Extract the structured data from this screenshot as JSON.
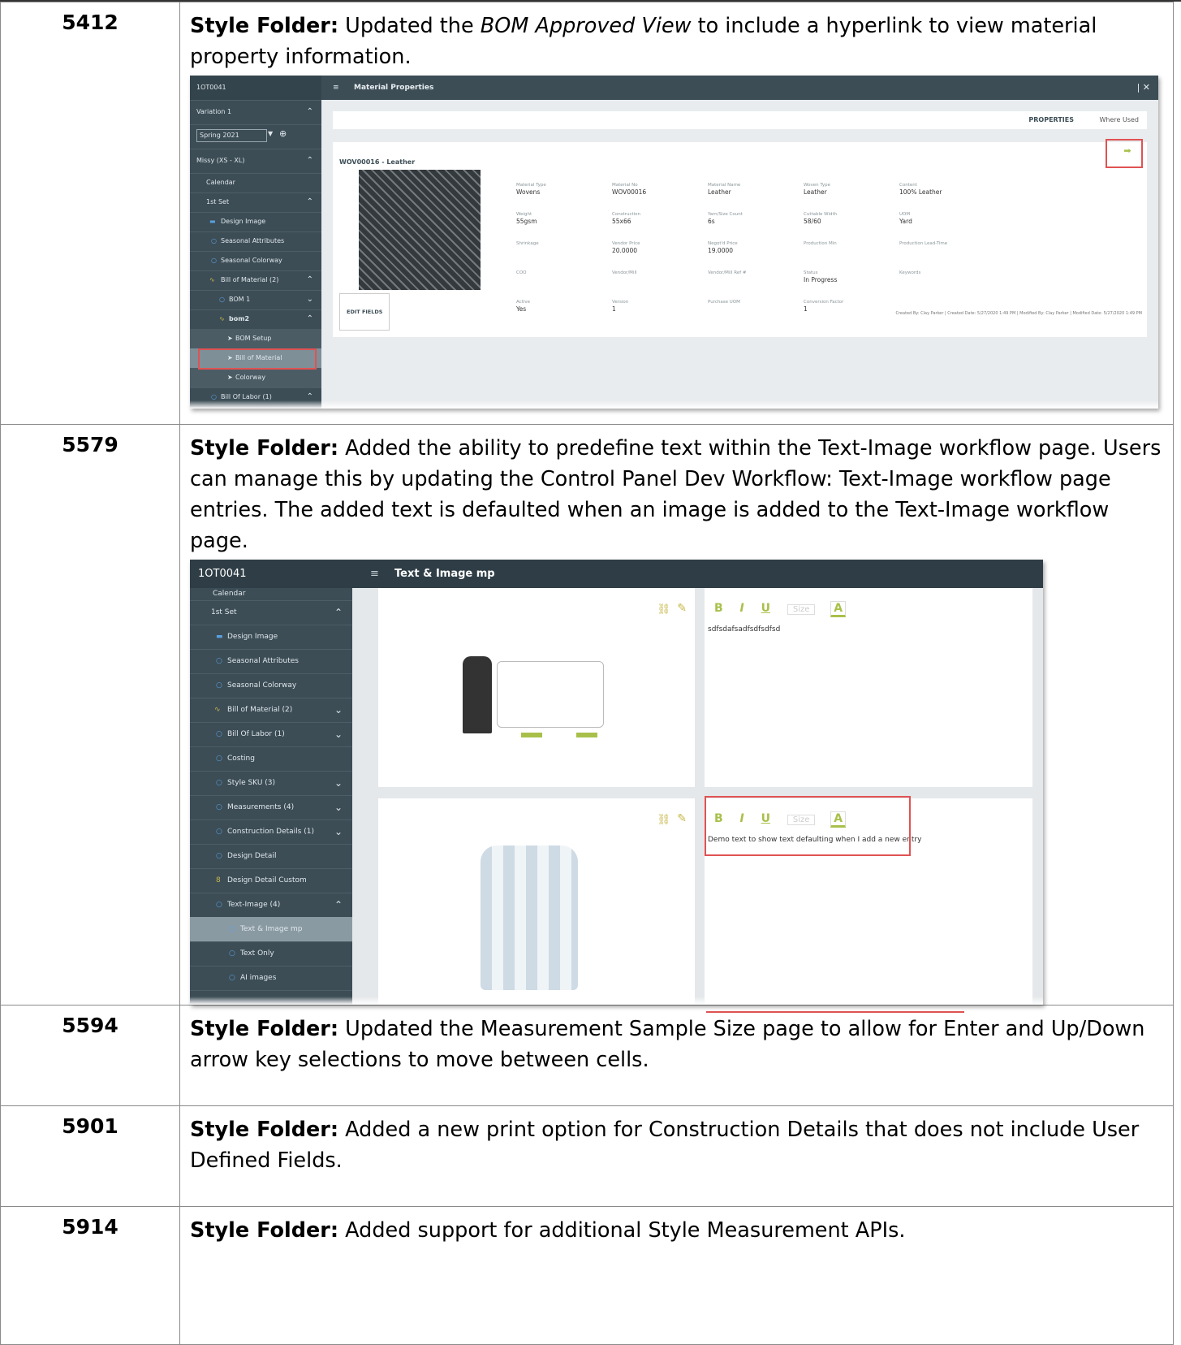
{
  "rows": [
    {
      "id": "5412",
      "lead": "Style Folder:",
      "text_before": " Updated the ",
      "italic": "BOM Approved View",
      "text_after": " to include a hyperlink to view material property information."
    },
    {
      "id": "5579",
      "lead": "Style Folder:",
      "text": " Added the ability to predefine text within the Text-Image workflow page. Users can manage this by updating the Control Panel Dev Workflow: Text-Image workflow page entries. The added text is defaulted when an image is added to the Text-Image workflow page."
    },
    {
      "id": "5594",
      "lead": "Style Folder:",
      "text": " Updated the Measurement Sample Size page to allow for Enter and Up/Down arrow key selections to move between cells."
    },
    {
      "id": "5901",
      "lead": "Style Folder:",
      "text": "  Added a new print option for Construction Details that does not include User Defined Fields."
    },
    {
      "id": "5914",
      "lead": "Style Folder:",
      "text": " Added support for additional Style Measurement APIs."
    }
  ],
  "shot1": {
    "code": "1OT0041",
    "variation": "Variation 1",
    "season": "Spring 2021",
    "size": "Missy (XS - XL)",
    "side_items": [
      "Calendar",
      "1st Set",
      "Design Image",
      "Seasonal Attributes",
      "Seasonal Colorway",
      "Bill of Material (2)",
      "BOM 1",
      "bom2",
      "BOM Setup",
      "Bill of Material",
      "Colorway",
      "Bill Of Labor (1)"
    ],
    "title": "Material Properties",
    "tab_properties": "PROPERTIES",
    "tab_where": "Where Used",
    "material": "WOV00016 - Leather",
    "fields": [
      {
        "l": "Material Type",
        "v": "Wovens"
      },
      {
        "l": "Material No",
        "v": "WOV00016"
      },
      {
        "l": "Material Name",
        "v": "Leather"
      },
      {
        "l": "Woven Type",
        "v": "Leather"
      },
      {
        "l": "Content",
        "v": "100% Leather"
      },
      {
        "l": "Weight",
        "v": "55gsm"
      },
      {
        "l": "Construction",
        "v": "55x66"
      },
      {
        "l": "Yarn/Size Count",
        "v": "6s"
      },
      {
        "l": "Cuttable Width",
        "v": "58/60"
      },
      {
        "l": "UOM",
        "v": "Yard"
      },
      {
        "l": "Shrinkage",
        "v": ""
      },
      {
        "l": "Vendor Price",
        "v": "20.0000"
      },
      {
        "l": "Negot'd Price",
        "v": "19.0000"
      },
      {
        "l": "Production Min",
        "v": ""
      },
      {
        "l": "Production Lead-Time",
        "v": ""
      },
      {
        "l": "COO",
        "v": ""
      },
      {
        "l": "Vendor/Mill",
        "v": ""
      },
      {
        "l": "Vendor/Mill Ref #",
        "v": ""
      },
      {
        "l": "Status",
        "v": "In Progress"
      },
      {
        "l": "Keywords",
        "v": ""
      },
      {
        "l": "Active",
        "v": "Yes"
      },
      {
        "l": "Version",
        "v": "1"
      },
      {
        "l": "Purchase UOM",
        "v": ""
      },
      {
        "l": "Conversion Factor",
        "v": "1"
      },
      {
        "l": "",
        "v": ""
      }
    ],
    "edit": "EDIT FIELDS",
    "footer": "Created By: Clay Parker | Created Date: 5/27/2020 1:49 PM | Modified By: Clay Parker | Modified Date: 5/27/2020 1:49 PM"
  },
  "shot2": {
    "code": "1OT0041",
    "title": "Text & Image mp",
    "side_items": [
      "Calendar",
      "1st Set",
      "Design Image",
      "Seasonal Attributes",
      "Seasonal Colorway",
      "Bill of Material (2)",
      "Bill Of Labor (1)",
      "Costing",
      "Style SKU (3)",
      "Measurements (4)",
      "Construction Details (1)",
      "Design Detail",
      "Design Detail Custom",
      "Text-Image (4)",
      "Text & Image mp",
      "Text Only",
      "AI images"
    ],
    "toolbar": {
      "bold": "B",
      "italic": "I",
      "underline": "U",
      "size": "Size",
      "color": "A"
    },
    "text1": "sdfsdafsadfsdfsdfsd",
    "text2": "Demo text to show text defaulting when I add a new entry"
  },
  "colors": {
    "sidebar": "#3c4d56",
    "highlight": "#e05252",
    "accent": "#a8c04a"
  }
}
